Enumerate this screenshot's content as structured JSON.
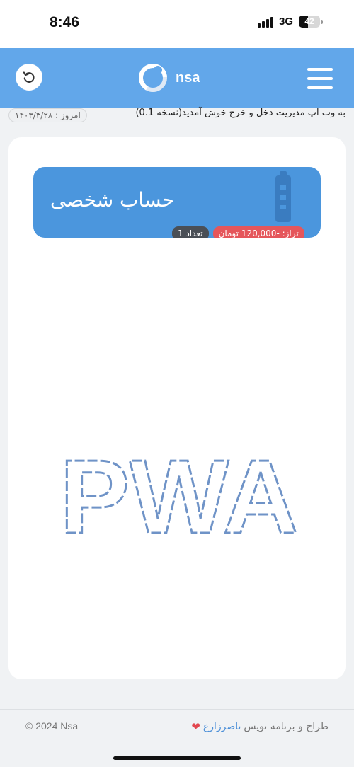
{
  "status_bar": {
    "time": "8:46",
    "network": "3G",
    "battery": "42",
    "battery_level": 0.42
  },
  "header": {
    "brand_name": "nsa",
    "refresh_icon": "refresh-icon",
    "menu_icon": "hamburger-icon",
    "colors": {
      "background": "#62a7ea"
    }
  },
  "welcome": {
    "message": "به وب اپ مدیریت دخل و خرج خوش آمدید(نسخه 0.1)",
    "today_label": "امروز : ۱۴۰۳/۳/۲۸"
  },
  "account": {
    "title": "حساب شخصی",
    "balance_label": "تراز: -120,000 تومان",
    "count_label": "تعداد 1",
    "icon": "wallet-icon",
    "colors": {
      "card": "#4b96dd",
      "balance_badge": "#e5565b",
      "count_badge": "#4a4f56"
    }
  },
  "graphic": {
    "text": "PWA",
    "color": "#6f93c7"
  },
  "footer": {
    "copyright": "© 2024 Nsa",
    "credit_prefix": "طراح و برنامه نویس",
    "credit_name": "ناصرزارع",
    "heart": "❤"
  }
}
